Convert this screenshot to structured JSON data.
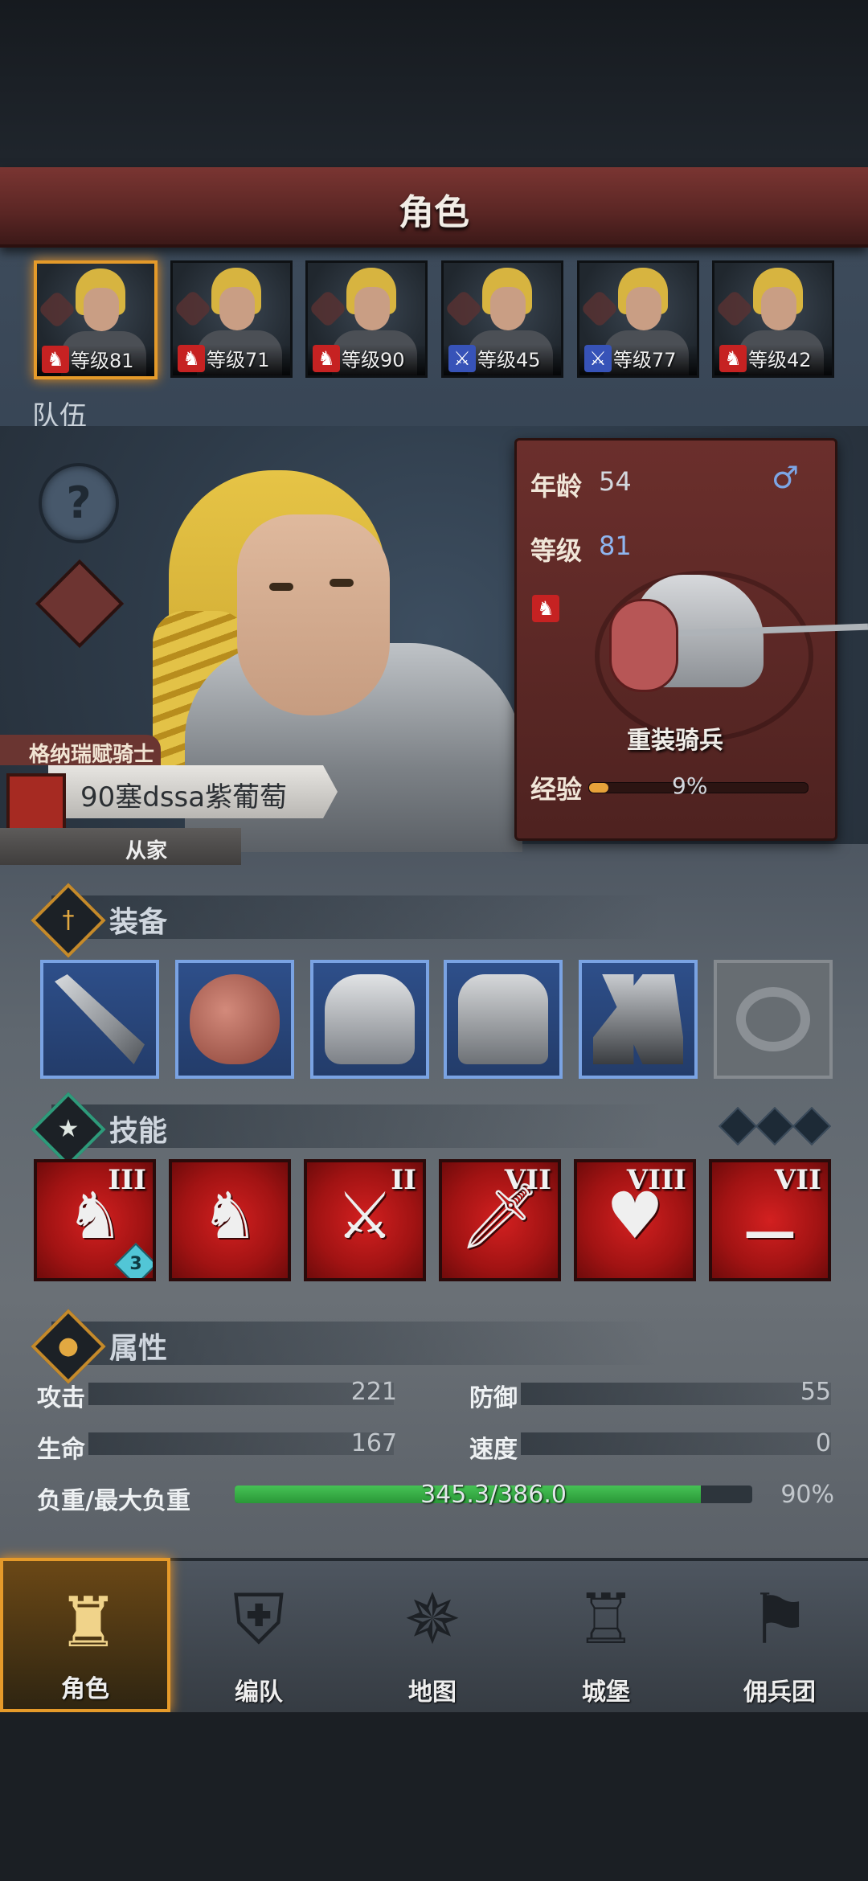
{
  "screen_title": "角色",
  "roster": [
    {
      "level_text": "等级81",
      "class_icon": "horse",
      "active": true
    },
    {
      "level_text": "等级71",
      "class_icon": "horse",
      "active": false
    },
    {
      "level_text": "等级90",
      "class_icon": "horse",
      "active": false
    },
    {
      "level_text": "等级45",
      "class_icon": "sword",
      "active": false
    },
    {
      "level_text": "等级77",
      "class_icon": "sword",
      "active": false
    },
    {
      "level_text": "等级42",
      "class_icon": "horse",
      "active": false
    }
  ],
  "team_label": "队伍",
  "hero": {
    "title": "格纳瑞赋骑士",
    "name": "90塞dssa紫葡萄",
    "role": "从家"
  },
  "info": {
    "age_label": "年龄",
    "age_value": "54",
    "gender_icon": "♂",
    "level_label": "等级",
    "level_value": "81",
    "unit_name": "重装骑兵",
    "exp_label": "经验",
    "exp_percent_text": "9%",
    "exp_fraction": 0.09
  },
  "equipment": {
    "title": "装备",
    "slots": [
      {
        "name": "lance-icon",
        "empty": false
      },
      {
        "name": "shield-icon",
        "empty": false
      },
      {
        "name": "helmet-icon",
        "empty": false
      },
      {
        "name": "armor-icon",
        "empty": false
      },
      {
        "name": "boots-icon",
        "empty": false
      },
      {
        "name": "ring-icon",
        "empty": true
      }
    ]
  },
  "skills": {
    "title": "技能",
    "items": [
      {
        "glyph": "♞",
        "rank": "III",
        "badge": "3"
      },
      {
        "glyph": "♞",
        "rank": "",
        "badge": ""
      },
      {
        "glyph": "⚔",
        "rank": "II",
        "badge": ""
      },
      {
        "glyph": "🗡",
        "rank": "VII",
        "badge": ""
      },
      {
        "glyph": "♥",
        "rank": "VIII",
        "badge": ""
      },
      {
        "glyph": "⚊",
        "rank": "VII",
        "badge": ""
      }
    ]
  },
  "attributes": {
    "title": "属性",
    "attack_label": "攻击",
    "attack_value": "221",
    "defense_label": "防御",
    "defense_value": "55",
    "hp_label": "生命",
    "hp_value": "167",
    "speed_label": "速度",
    "speed_value": "0",
    "load_label": "负重/最大负重",
    "load_value": "345.3/386.0",
    "load_percent_text": "90%",
    "load_fraction": 0.9
  },
  "nav": [
    {
      "label": "角色",
      "icon": "knight-icon",
      "active": true
    },
    {
      "label": "编队",
      "icon": "helmet-formation-icon",
      "active": false
    },
    {
      "label": "地图",
      "icon": "compass-icon",
      "active": false
    },
    {
      "label": "城堡",
      "icon": "castle-icon",
      "active": false
    },
    {
      "label": "佣兵团",
      "icon": "mercenary-icon",
      "active": false
    }
  ]
}
